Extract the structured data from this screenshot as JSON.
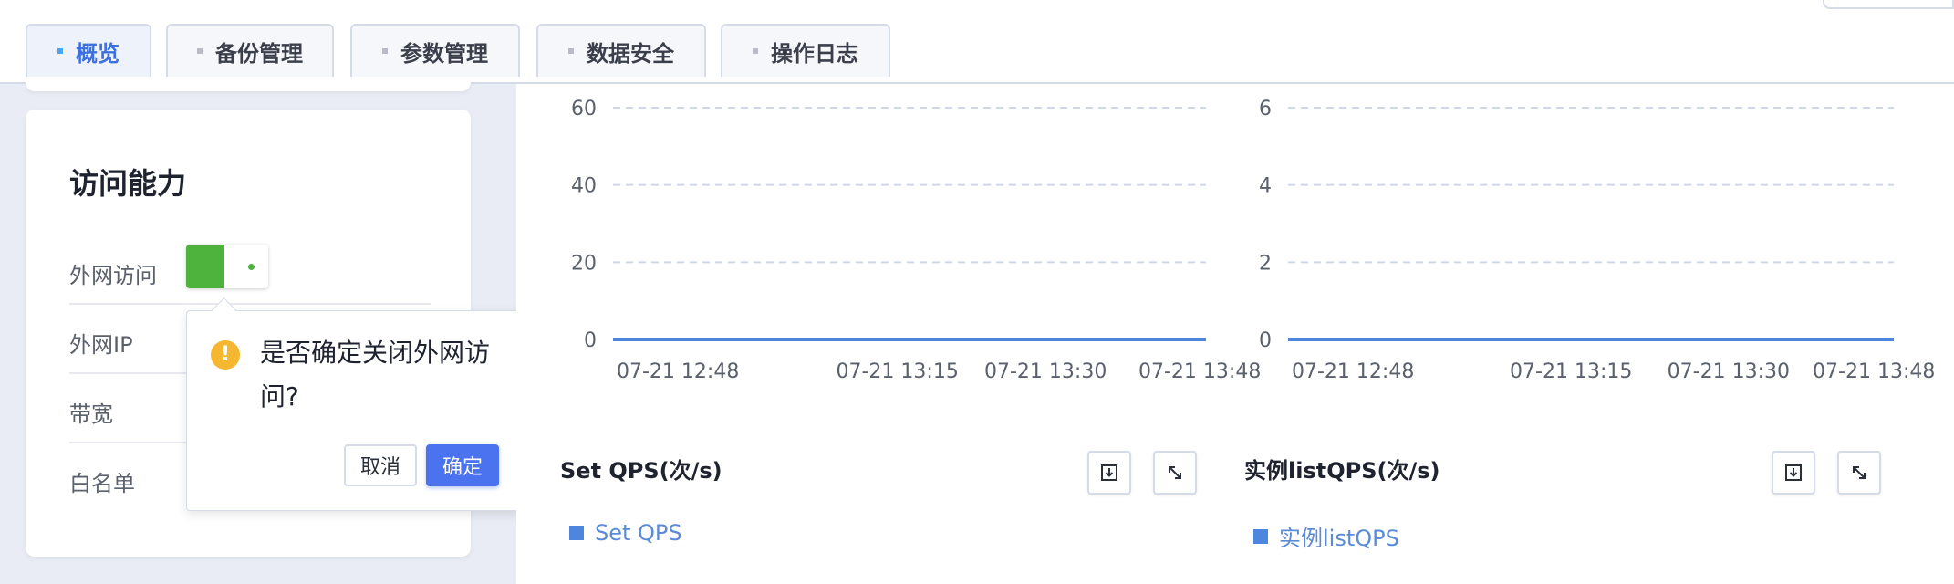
{
  "tabs": [
    {
      "label": "概览",
      "active": true
    },
    {
      "label": "备份管理",
      "active": false
    },
    {
      "label": "参数管理",
      "active": false
    },
    {
      "label": "数据安全",
      "active": false
    },
    {
      "label": "操作日志",
      "active": false
    }
  ],
  "access": {
    "title": "访问能力",
    "rows": [
      {
        "label": "外网访问"
      },
      {
        "label": "外网IP"
      },
      {
        "label": "带宽"
      },
      {
        "label": "白名单"
      }
    ],
    "switch_on": true
  },
  "popconfirm": {
    "message": "是否确定关闭外网访问?",
    "cancel_label": "取消",
    "ok_label": "确定"
  },
  "colors": {
    "primary": "#4b72ef",
    "switch_on": "#4db33d",
    "warning": "#f5b730",
    "series": "#4f86dd"
  },
  "chart_data": [
    {
      "type": "line",
      "title": "",
      "x": [
        "07-21 12:48",
        "07-21 13:15",
        "07-21 13:30",
        "07-21 13:48"
      ],
      "yticks": [
        0,
        20,
        40,
        60
      ],
      "ylim": [
        0,
        60
      ],
      "series": [
        {
          "values": [
            0,
            0,
            0,
            0
          ]
        }
      ],
      "grid": true
    },
    {
      "type": "line",
      "title": "",
      "x": [
        "07-21 12:48",
        "07-21 13:15",
        "07-21 13:30",
        "07-21 13:48"
      ],
      "yticks": [
        0,
        2,
        4,
        6
      ],
      "ylim": [
        0,
        6
      ],
      "series": [
        {
          "values": [
            0,
            0,
            0,
            0
          ]
        }
      ],
      "grid": true
    },
    {
      "type": "line",
      "title": "Set QPS(次/s)",
      "series": [
        {
          "name": "Set QPS",
          "values": []
        }
      ]
    },
    {
      "type": "line",
      "title": "实例listQPS(次/s)",
      "series": [
        {
          "name": "实例listQPS",
          "values": []
        }
      ]
    }
  ]
}
